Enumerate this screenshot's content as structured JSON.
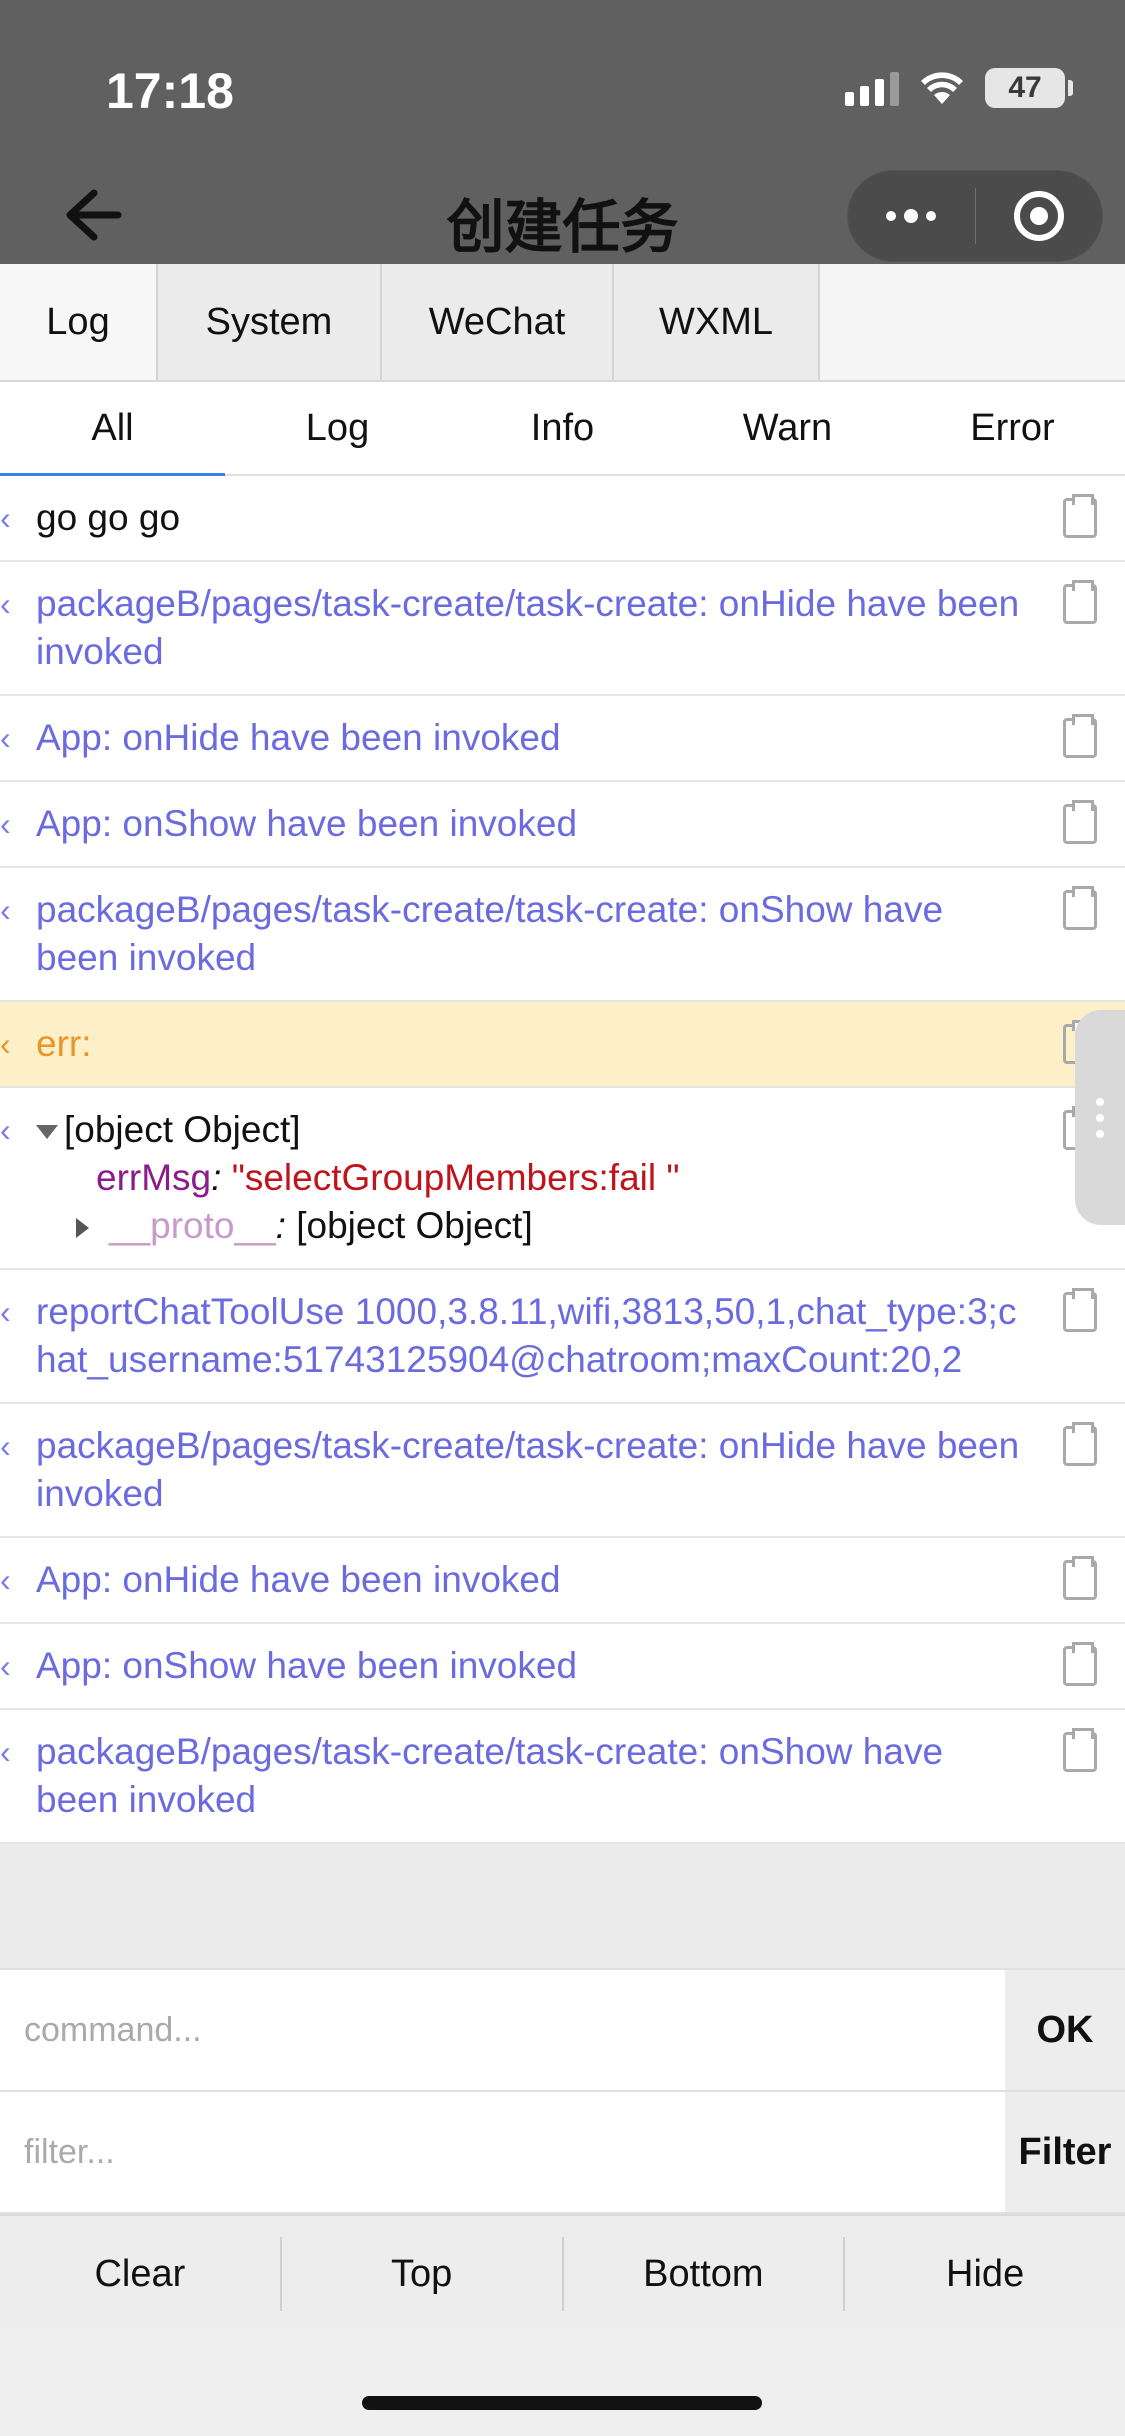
{
  "status": {
    "time": "17:18",
    "battery": "47"
  },
  "nav": {
    "title": "创建任务"
  },
  "main_tabs": [
    {
      "label": "Log",
      "width": 158
    },
    {
      "label": "System",
      "width": 224
    },
    {
      "label": "WeChat",
      "width": 232
    },
    {
      "label": "WXML",
      "width": 206
    }
  ],
  "sub_tabs": [
    "All",
    "Log",
    "Info",
    "Warn",
    "Error"
  ],
  "logs": [
    {
      "type": "log",
      "text": "go go go"
    },
    {
      "type": "info",
      "text": "packageB/pages/task-create/task-create: onHide have been invoked"
    },
    {
      "type": "info",
      "text": "App: onHide have been invoked"
    },
    {
      "type": "info",
      "text": "App: onShow have been invoked"
    },
    {
      "type": "info",
      "text": "packageB/pages/task-create/task-create: onShow have been invoked"
    },
    {
      "type": "warn",
      "text": "err:"
    },
    {
      "type": "object",
      "summary": "[object Object]",
      "key1": "errMsg",
      "value1": "\"selectGroupMembers:fail \"",
      "key2": "__proto__",
      "value2": "[object Object]"
    },
    {
      "type": "info",
      "text": "reportChatToolUse 1000,3.8.11,wifi,3813,50,1,chat_type:3;chat_username:51743125904@chatroom;maxCount:20,2"
    },
    {
      "type": "info",
      "text": "packageB/pages/task-create/task-create: onHide have been invoked"
    },
    {
      "type": "info",
      "text": "App: onHide have been invoked"
    },
    {
      "type": "info",
      "text": "App: onShow have been invoked"
    },
    {
      "type": "info",
      "text": "packageB/pages/task-create/task-create: onShow have been invoked"
    }
  ],
  "command": {
    "placeholder": "command...",
    "button": "OK"
  },
  "filter": {
    "placeholder": "filter...",
    "button": "Filter"
  },
  "toolbar": [
    "Clear",
    "Top",
    "Bottom",
    "Hide"
  ],
  "colors": {
    "accent": "#3b7df0",
    "info": "#6b6be0",
    "warn_bg": "#fdf0c9",
    "warn_text": "#e8952a",
    "header_bg": "#606060"
  }
}
